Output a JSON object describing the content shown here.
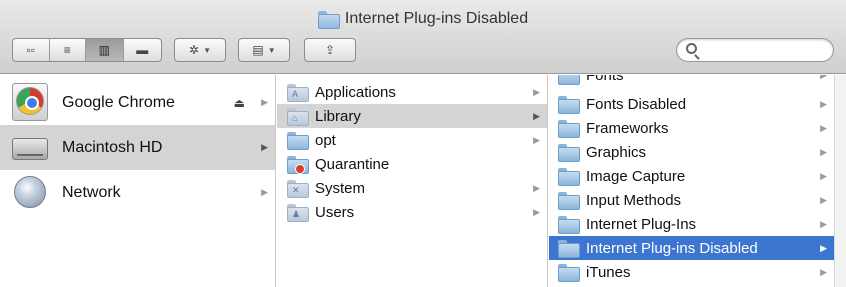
{
  "window": {
    "title": "Internet Plug-ins Disabled"
  },
  "toolbar": {
    "view_buttons": [
      {
        "name": "icon-view-button",
        "glyph": "▫▫"
      },
      {
        "name": "list-view-button",
        "glyph": "≡"
      },
      {
        "name": "column-view-button",
        "glyph": "▥",
        "active": true
      },
      {
        "name": "coverflow-view-button",
        "glyph": "▬"
      }
    ],
    "action_glyph": "✲",
    "arrange_glyph": "▤",
    "share_glyph": "⇪",
    "search_placeholder": ""
  },
  "sidebar": {
    "items": [
      {
        "label": "Google Chrome",
        "icon": "chrome-disk-icon",
        "eject": "⏏"
      },
      {
        "label": "Macintosh HD",
        "icon": "hard-drive-icon",
        "selected": true
      },
      {
        "label": "Network",
        "icon": "network-globe-icon"
      }
    ]
  },
  "column1": {
    "items": [
      {
        "label": "Applications",
        "icon": "applications-folder-icon",
        "arrow": true
      },
      {
        "label": "Library",
        "icon": "library-folder-icon",
        "arrow": true,
        "selected": true
      },
      {
        "label": "opt",
        "icon": "folder-icon",
        "arrow": true
      },
      {
        "label": "Quarantine",
        "icon": "restricted-folder-icon"
      },
      {
        "label": "System",
        "icon": "system-folder-icon",
        "arrow": true
      },
      {
        "label": "Users",
        "icon": "users-folder-icon",
        "arrow": true
      }
    ]
  },
  "column2": {
    "items": [
      {
        "label": "Fonts",
        "partial": true
      },
      {
        "label": "Fonts Disabled"
      },
      {
        "label": "Frameworks"
      },
      {
        "label": "Graphics"
      },
      {
        "label": "Image Capture"
      },
      {
        "label": "Input Methods"
      },
      {
        "label": "Internet Plug-Ins"
      },
      {
        "label": "Internet Plug-ins Disabled",
        "selected": true
      },
      {
        "label": "iTunes"
      }
    ]
  },
  "glyphs": {
    "arrow": "▶"
  },
  "colors": {
    "selection_blue": "#3d76d1",
    "selection_grey": "#d4d4d4"
  }
}
